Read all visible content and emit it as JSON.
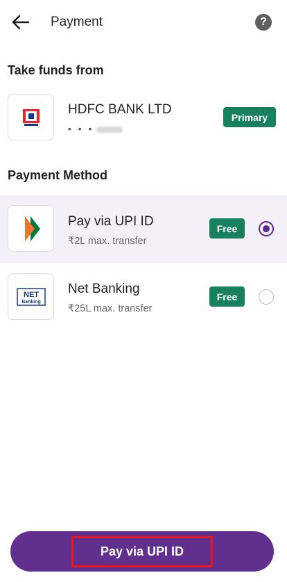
{
  "header": {
    "title": "Payment",
    "help_glyph": "?"
  },
  "funds": {
    "section_title": "Take funds from",
    "bank_name": "HDFC BANK LTD",
    "account_masked": "• • •",
    "badge": "Primary",
    "logo_icon": "hdfc-bank-logo"
  },
  "payment_method": {
    "section_title": "Payment Method",
    "options": [
      {
        "title": "Pay via UPI ID",
        "subtitle": "₹2L max. transfer",
        "badge": "Free",
        "icon": "upi-logo",
        "selected": true
      },
      {
        "title": "Net Banking",
        "subtitle": "₹25L max. transfer",
        "badge": "Free",
        "icon": "net-banking-logo",
        "selected": false
      }
    ]
  },
  "footer": {
    "cta_label": "Pay via UPI ID"
  },
  "colors": {
    "brand_purple": "#612f8d",
    "radio_purple": "#5b2c8e",
    "badge_green": "#17805d",
    "selected_row_bg": "#f3f0f7",
    "highlight_red": "#e8171c"
  }
}
